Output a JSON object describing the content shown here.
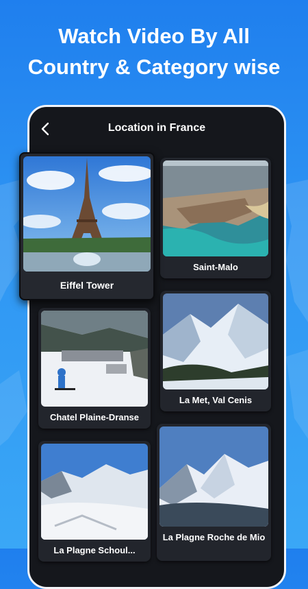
{
  "headline": {
    "line1": "Watch Video By All",
    "line2": "Country & Category wise"
  },
  "screen": {
    "title": "Location in France",
    "back_icon": "chevron-left-icon"
  },
  "locations": [
    {
      "name": "Eiffel Tower"
    },
    {
      "name": "Saint-Malo"
    },
    {
      "name": "Chatel Plaine-Dranse"
    },
    {
      "name": "La Met, Val Cenis"
    },
    {
      "name": "La Plagne Schoul..."
    },
    {
      "name": "La Plagne Roche de Mio"
    }
  ],
  "colors": {
    "background_top": "#1f7fee",
    "background_bottom": "#3aa7f6",
    "phone_bg": "#15171c",
    "card_bg": "#22252c"
  }
}
